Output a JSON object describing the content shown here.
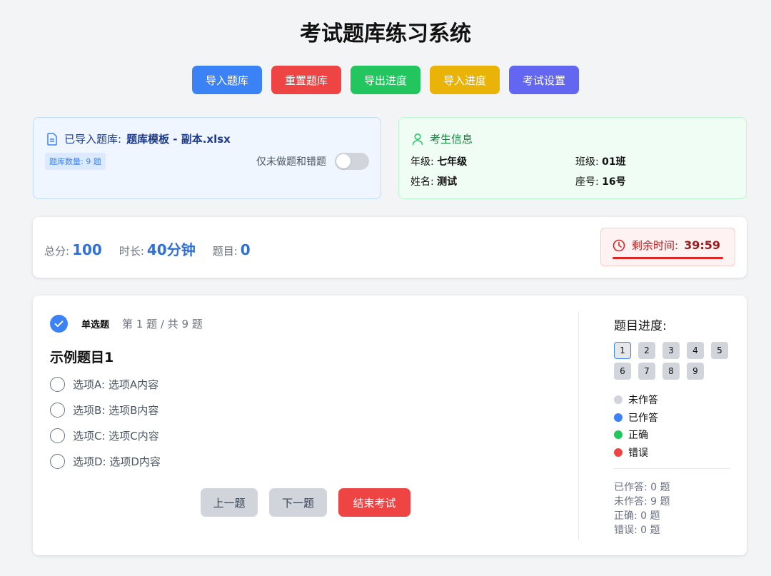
{
  "header": {
    "title": "考试题库练习系统"
  },
  "toolbar": {
    "buttons": [
      {
        "label": "导入题库",
        "color": "#3b82f6"
      },
      {
        "label": "重置题库",
        "color": "#ef4444"
      },
      {
        "label": "导出进度",
        "color": "#22c55e"
      },
      {
        "label": "导入进度",
        "color": "#eab308"
      },
      {
        "label": "考试设置",
        "color": "#6366f1"
      }
    ]
  },
  "bank": {
    "label": "已导入题库:",
    "filename": "题库模板 - 副本.xlsx",
    "count_badge": "题库数量: 9 题",
    "filter_label": "仅未做题和错题",
    "filter_on": false,
    "icon": "document-icon"
  },
  "examinee": {
    "title": "考生信息",
    "icon": "user-icon",
    "grade_label": "年级:",
    "grade_value": "七年级",
    "class_label": "班级:",
    "class_value": "01班",
    "name_label": "姓名:",
    "name_value": "测试",
    "seat_label": "座号:",
    "seat_value": "16号"
  },
  "summary": {
    "score_label": "总分:",
    "score_value": "100",
    "duration_label": "时长:",
    "duration_value": "40分钟",
    "questions_label": "题目:",
    "questions_value": "0",
    "timer_label": "剩余时间:",
    "timer_value": "39:59",
    "timer_icon": "clock-icon",
    "timer_color": "#dc2626"
  },
  "question": {
    "type": "单选题",
    "position": "第 1 题 / 共 9 题",
    "title": "示例题目1",
    "options": [
      {
        "text": "选项A: 选项A内容"
      },
      {
        "text": "选项B: 选项B内容"
      },
      {
        "text": "选项C: 选项C内容"
      },
      {
        "text": "选项D: 选项D内容"
      }
    ],
    "prev_label": "上一题",
    "next_label": "下一题",
    "finish_label": "结束考试"
  },
  "progress": {
    "title": "题目进度:",
    "numbers": [
      "1",
      "2",
      "3",
      "4",
      "5",
      "6",
      "7",
      "8",
      "9"
    ],
    "current": "1",
    "legend": [
      {
        "label": "未作答",
        "color": "#d1d5db"
      },
      {
        "label": "已作答",
        "color": "#3b82f6"
      },
      {
        "label": "正确",
        "color": "#22c55e"
      },
      {
        "label": "错误",
        "color": "#ef4444"
      }
    ],
    "stats": {
      "answered": "已作答: 0 题",
      "unanswered": "未作答: 9 题",
      "correct": "正确: 0 题",
      "wrong": "错误: 0 题"
    }
  }
}
